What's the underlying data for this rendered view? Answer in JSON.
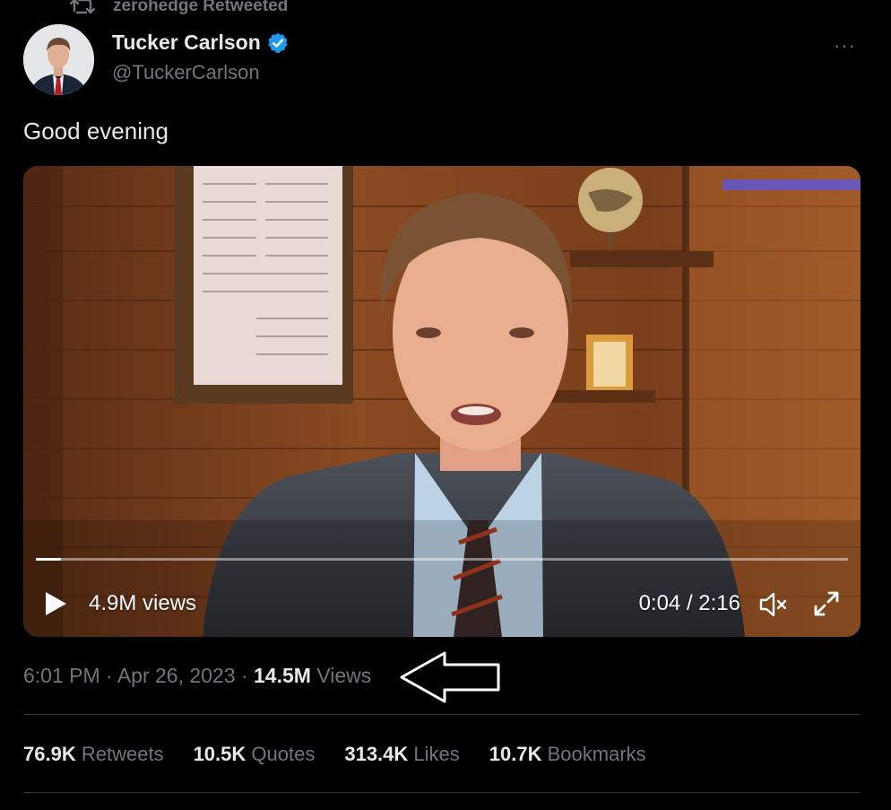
{
  "retweet_header": {
    "icon": "retweet-icon",
    "text": "zerohedge Retweeted"
  },
  "author": {
    "name": "Tucker Carlson",
    "handle": "@TuckerCarlson",
    "verified_color": "#1d9bf0"
  },
  "more_menu_label": "···",
  "tweet": {
    "text": "Good evening"
  },
  "video": {
    "views": "4.9M views",
    "time": "0:04 / 2:16",
    "progress": 0.031,
    "controls": [
      "play-icon",
      "mute-icon",
      "fullscreen-icon"
    ]
  },
  "meta": {
    "time": "6:01 PM",
    "date": "Apr 26, 2023",
    "views_count": "14.5M",
    "views_label": "Views",
    "sep": " · "
  },
  "stats": {
    "retweets_count": "76.9K",
    "retweets_label": "Retweets",
    "quotes_count": "10.5K",
    "quotes_label": "Quotes",
    "likes_count": "313.4K",
    "likes_label": "Likes",
    "bookmarks_count": "10.7K",
    "bookmarks_label": "Bookmarks"
  },
  "colors": {
    "background": "#000000",
    "muted": "#71767b",
    "text": "#e7e9ea",
    "divider": "#2f3336"
  }
}
